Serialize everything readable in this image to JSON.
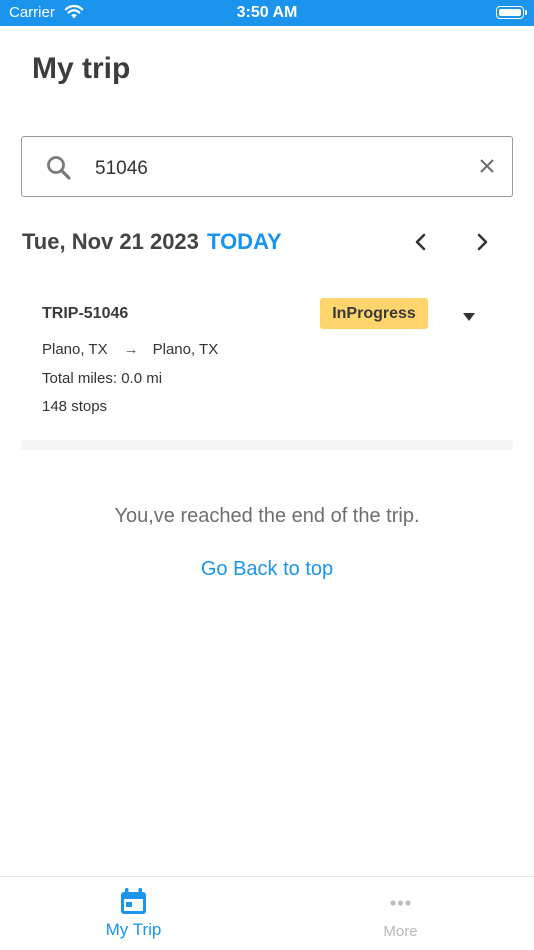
{
  "status_bar": {
    "carrier": "Carrier",
    "time": "3:50 AM"
  },
  "page": {
    "title": "My trip"
  },
  "search": {
    "value": "51046",
    "icon": "search-icon",
    "clear_icon": "close-icon"
  },
  "date_nav": {
    "date": "Tue, Nov 21 2023",
    "today_label": "TODAY"
  },
  "trip": {
    "id": "TRIP-51046",
    "status": "InProgress",
    "origin": "Plano, TX",
    "arrow": "→",
    "destination": "Plano, TX",
    "miles": "Total miles: 0.0 mi",
    "stops": "148 stops"
  },
  "footer": {
    "end_message": "You,ve reached the end of the trip.",
    "back_to_top": "Go Back to top"
  },
  "tab_bar": {
    "tabs": [
      {
        "label": "My Trip",
        "icon": "calendar-icon",
        "active": true
      },
      {
        "label": "More",
        "icon": "more-dots-icon",
        "active": false
      }
    ]
  },
  "colors": {
    "accent": "#1a94ec",
    "status_badge": "#fdd56c"
  }
}
